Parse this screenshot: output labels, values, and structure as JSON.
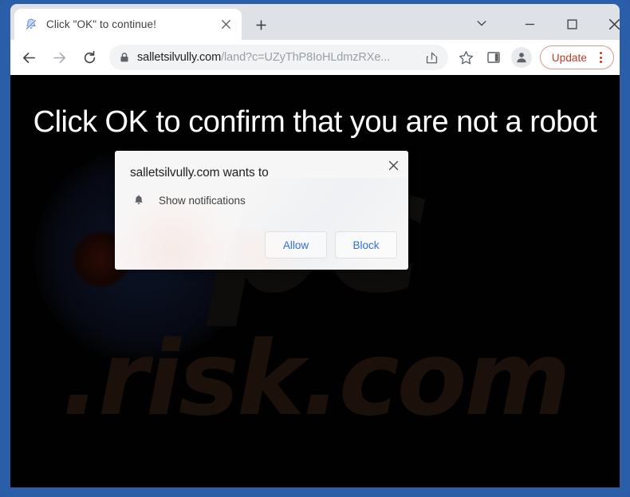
{
  "window": {
    "frame_color": "#2b5ea9",
    "controls": {
      "tab_search_label": "tab-search",
      "minimize_label": "Minimize",
      "maximize_label": "Maximize",
      "close_label": "Close"
    }
  },
  "tab_strip": {
    "tabs": [
      {
        "title": "Click \"OK\" to continue!",
        "favicon": "bell-slash-icon",
        "close_label": "Close tab",
        "active": true
      }
    ],
    "new_tab_label": "New Tab"
  },
  "toolbar": {
    "back_label": "Back",
    "forward_label": "Forward",
    "reload_label": "Reload",
    "lock_icon": "lock-icon",
    "url_host": "salletsilvully.com",
    "url_path": "/land?c=UZyThP8IoHLdmzRXe...",
    "url_full": "salletsilvully.com/land?c=UZyThP8IoHLdmzRXe...",
    "share_icon": "share-icon",
    "bookmark_icon": "star-icon",
    "side_panel_icon": "side-panel-icon",
    "profile_icon": "person-avatar-icon",
    "update_label": "Update",
    "update_color": "#c0392b",
    "menu_icon": "three-dot-menu-icon"
  },
  "page": {
    "background_color": "#010101",
    "headline_left": "Cli",
    "headline_right": "are not a robot",
    "headline_full": "Click OK to confirm that you are not a robot",
    "watermark_top": "pc",
    "watermark_bottom": ".risk.com",
    "watermark_color": "#1b110a"
  },
  "permission_dialog": {
    "title": "salletsilvully.com wants to",
    "permission_icon": "bell-icon",
    "permission_label": "Show notifications",
    "allow_label": "Allow",
    "block_label": "Block",
    "close_label": "Close",
    "button_text_color": "#2f6fe0"
  }
}
